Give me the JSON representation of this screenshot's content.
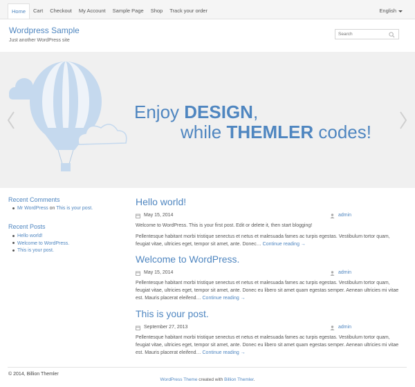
{
  "nav": {
    "items": [
      {
        "label": "Home",
        "active": true
      },
      {
        "label": "Cart",
        "active": false
      },
      {
        "label": "Checkout",
        "active": false
      },
      {
        "label": "My Account",
        "active": false
      },
      {
        "label": "Sample Page",
        "active": false
      },
      {
        "label": "Shop",
        "active": false
      },
      {
        "label": "Track your order",
        "active": false
      }
    ],
    "language": "English"
  },
  "header": {
    "site_title": "Wordpress Sample",
    "tagline": "Just another WordPress site",
    "search_placeholder": "Search"
  },
  "slider": {
    "line1_prefix": "Enjoy ",
    "line1_bold": "DESIGN",
    "line1_suffix": ",",
    "line2_prefix": "while ",
    "line2_bold": "THEMLER",
    "line2_suffix": " codes!",
    "prev_icon": "chevron-left-icon",
    "next_icon": "chevron-right-icon"
  },
  "sidebar": {
    "recent_comments_title": "Recent Comments",
    "comment": {
      "author": "Mr WordPress",
      "on": "on",
      "post": "This is your post."
    },
    "recent_posts_title": "Recent Posts",
    "recent_posts": [
      "Hello world!",
      "Welcome to WordPress.",
      "This is your post."
    ]
  },
  "posts": [
    {
      "title": "Hello world!",
      "date": "May 15, 2014",
      "author": "admin",
      "paragraphs": [
        "Welcome to WordPress. This is your first post. Edit or delete it, then start blogging!",
        "Pellentesque habitant morbi tristique senectus et netus et malesuada fames ac turpis egestas. Vestibulum tortor quam, feugiat vitae, ultricies eget, tempor sit amet, ante. Donec…"
      ],
      "more": "Continue reading →"
    },
    {
      "title": "Welcome to WordPress.",
      "date": "May 15, 2014",
      "author": "admin",
      "paragraphs": [
        "Pellentesque habitant morbi tristique senectus et netus et malesuada fames ac turpis egestas. Vestibulum tortor quam, feugiat vitae, ultricies eget, tempor sit amet, ante. Donec eu libero sit amet quam egestas semper. Aenean ultricies mi vitae est. Mauris placerat eleifend…"
      ],
      "more": "Continue reading →"
    },
    {
      "title": "This is your post.",
      "date": "September 27, 2013",
      "author": "admin",
      "paragraphs": [
        "Pellentesque habitant morbi tristique senectus et netus et malesuada fames ac turpis egestas. Vestibulum tortor quam, feugiat vitae, ultricies eget, tempor sit amet, ante. Donec eu libero sit amet quam egestas semper. Aenean ultricies mi vitae est. Mauris placerat eleifend…"
      ],
      "more": "Continue reading →"
    }
  ],
  "footer": {
    "copyright": "© 2014, Billion Themler",
    "credit_link1": "WordPress Theme",
    "credit_middle": " created with ",
    "credit_link2": "Billion Themler",
    "credit_end": "."
  },
  "colors": {
    "accent": "#4f86c0",
    "balloon": "#c5d9ee",
    "slider_bg": "#f0f0f0"
  }
}
